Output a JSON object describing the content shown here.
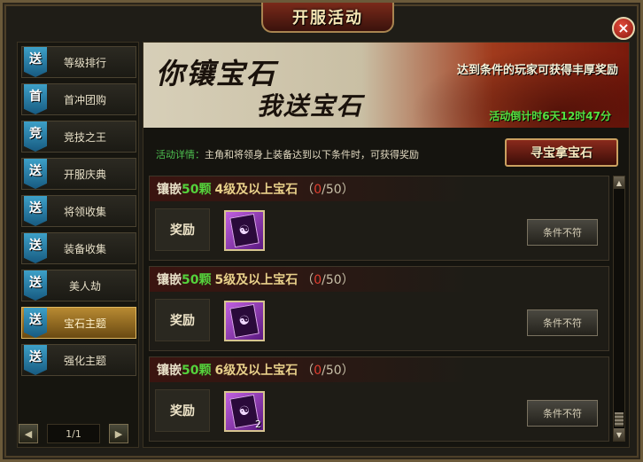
{
  "window": {
    "title": "开服活动",
    "close_label": "×"
  },
  "sidebar": {
    "items": [
      {
        "tag": "送",
        "label": "等级排行",
        "active": false
      },
      {
        "tag": "首",
        "label": "首冲团购",
        "active": false
      },
      {
        "tag": "竞",
        "label": "竞技之王",
        "active": false
      },
      {
        "tag": "送",
        "label": "开服庆典",
        "active": false
      },
      {
        "tag": "送",
        "label": "将领收集",
        "active": false
      },
      {
        "tag": "送",
        "label": "装备收集",
        "active": false
      },
      {
        "tag": "送",
        "label": "美人劫",
        "active": false
      },
      {
        "tag": "送",
        "label": "宝石主题",
        "active": true
      },
      {
        "tag": "送",
        "label": "强化主题",
        "active": false
      }
    ],
    "pager": {
      "prev_icon": "◀",
      "next_icon": "▶",
      "page_text": "1/1"
    }
  },
  "banner": {
    "line1": "你镶宝石",
    "line2": "我送宝石",
    "description": "达到条件的玩家可获得丰厚奖励",
    "countdown": "活动倒计时6天12时47分"
  },
  "detail": {
    "label": "活动详情：",
    "text": "主角和将领身上装备达到以下条件时，可获得奖励"
  },
  "seek_button": "寻宝拿宝石",
  "rows": [
    {
      "inlay": "镶嵌",
      "count": "50颗",
      "gem": "4级及以上宝石",
      "current": "0",
      "total": "/50",
      "reward_label": "奖励",
      "item_qty": "",
      "button": "条件不符"
    },
    {
      "inlay": "镶嵌",
      "count": "50颗",
      "gem": "5级及以上宝石",
      "current": "0",
      "total": "/50",
      "reward_label": "奖励",
      "item_qty": "",
      "button": "条件不符"
    },
    {
      "inlay": "镶嵌",
      "count": "50颗",
      "gem": "6级及以上宝石",
      "current": "0",
      "total": "/50",
      "reward_label": "奖励",
      "item_qty": "2",
      "button": "条件不符"
    }
  ],
  "scrollbar": {
    "up_icon": "▲",
    "down_icon": "▼"
  }
}
